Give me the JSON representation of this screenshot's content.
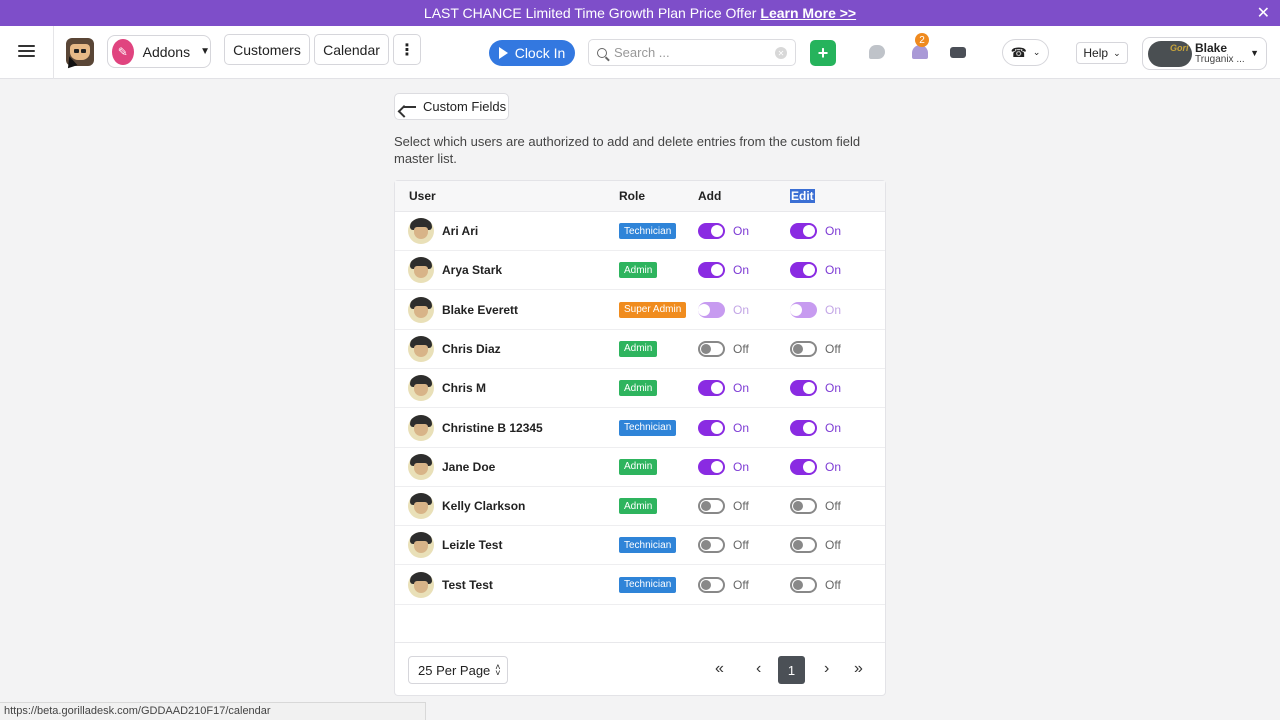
{
  "promo": {
    "text": "LAST CHANCE Limited Time Growth Plan Price Offer",
    "link": "Learn More >>",
    "close": "✕"
  },
  "header": {
    "addons_label": "Addons",
    "customers_label": "Customers",
    "calendar_label": "Calendar",
    "more_label": "⋮",
    "clock_in_label": "Clock In",
    "search_placeholder": "Search ...",
    "add_label": "+",
    "notification_count": "2",
    "help_label": "Help",
    "user_name": "Blake",
    "user_company": "Truganix ...",
    "user_logo_text": "Gori"
  },
  "page": {
    "back_label": "Custom Fields",
    "description": "Select which users are authorized to add and delete entries from the custom field master list."
  },
  "table": {
    "columns": {
      "user": "User",
      "role": "Role",
      "add": "Add",
      "edit": "Edit"
    },
    "rows": [
      {
        "name": "Ari Ari",
        "role": "Technician",
        "add": "On",
        "edit": "On",
        "add_state": "on",
        "edit_state": "on"
      },
      {
        "name": "Arya Stark",
        "role": "Admin",
        "add": "On",
        "edit": "On",
        "add_state": "on",
        "edit_state": "on"
      },
      {
        "name": "Blake Everett",
        "role": "Super Admin",
        "add": "On",
        "edit": "On",
        "add_state": "disabled",
        "edit_state": "disabled"
      },
      {
        "name": "Chris Diaz",
        "role": "Admin",
        "add": "Off",
        "edit": "Off",
        "add_state": "off",
        "edit_state": "off"
      },
      {
        "name": "Chris M",
        "role": "Admin",
        "add": "On",
        "edit": "On",
        "add_state": "on",
        "edit_state": "on"
      },
      {
        "name": "Christine B 12345",
        "role": "Technician",
        "add": "On",
        "edit": "On",
        "add_state": "on",
        "edit_state": "on"
      },
      {
        "name": "Jane Doe",
        "role": "Admin",
        "add": "On",
        "edit": "On",
        "add_state": "on",
        "edit_state": "on"
      },
      {
        "name": "Kelly Clarkson",
        "role": "Admin",
        "add": "Off",
        "edit": "Off",
        "add_state": "off",
        "edit_state": "off"
      },
      {
        "name": "Leizle Test",
        "role": "Technician",
        "add": "Off",
        "edit": "Off",
        "add_state": "off",
        "edit_state": "off"
      },
      {
        "name": "Test Test",
        "role": "Technician",
        "add": "Off",
        "edit": "Off",
        "add_state": "off",
        "edit_state": "off"
      }
    ]
  },
  "pagination": {
    "per_page": "25 Per Page",
    "current_page": "1",
    "first": "«",
    "prev": "‹",
    "next": "›",
    "last": "»"
  },
  "status_url": "https://beta.gorilladesk.com/GDDAAD210F17/calendar",
  "colors": {
    "promo": "#7e4ec9",
    "toggle_on": "#8a2be2",
    "technician": "#2f84d8",
    "admin": "#2eb45e",
    "super_admin": "#f08c1e",
    "clock_in": "#3378e0"
  }
}
